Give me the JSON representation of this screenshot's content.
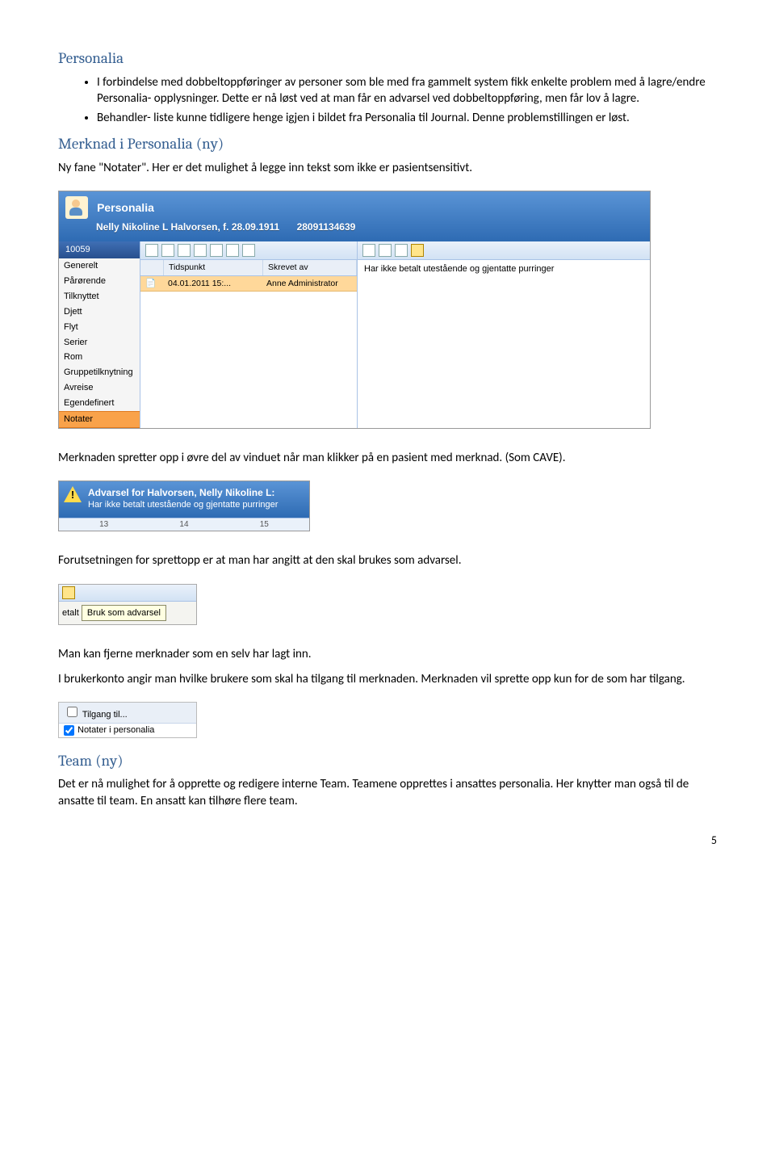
{
  "sections": {
    "personalia": {
      "heading": "Personalia",
      "bullets": [
        "I forbindelse med dobbeltoppføringer av personer som ble med fra gammelt system fikk enkelte problem med å lagre/endre Personalia- opplysninger. Dette er nå løst ved at man får en advarsel ved dobbeltoppføring, men får lov å lagre.",
        "Behandler- liste kunne tidligere henge igjen i bildet fra Personalia til Journal. Denne problemstillingen er løst."
      ]
    },
    "merknad": {
      "heading": "Merknad i Personalia (ny)",
      "intro": "Ny fane \"Notater\". Her er det mulighet å legge inn tekst som ikke er pasientsensitivt."
    },
    "body_p1": "Merknaden spretter opp i øvre del av vinduet når man klikker på en pasient med merknad. (Som CAVE).",
    "body_p2": "Forutsetningen for sprettopp er at man har angitt at den skal brukes som advarsel.",
    "body_p3": "Man kan fjerne merknader som en selv har lagt inn.",
    "body_p4": "I brukerkonto angir man hvilke brukere som skal ha tilgang til merknaden. Merknaden vil sprette opp kun for de som har tilgang.",
    "team": {
      "heading": "Team (ny)",
      "body": "Det er nå mulighet for å opprette og redigere interne Team. Teamene opprettes i ansattes personalia. Her knytter man også til de ansatte til team. En ansatt kan tilhøre flere team."
    }
  },
  "pwin": {
    "title": "Personalia",
    "subtitle": "Nelly Nikoline L Halvorsen, f. 28.09.1911",
    "idnum": "28091134639",
    "sidetab": "10059",
    "sidebar": [
      "Generelt",
      "Pårørende",
      "Tilknyttet",
      "Djett",
      "Flyt",
      "Serier",
      "Rom",
      "Gruppetilknytning",
      "Avreise",
      "Egendefinert",
      "Notater"
    ],
    "selected": "Notater",
    "listhead": {
      "c1": "",
      "c2": "Tidspunkt",
      "c3": "Skrevet av"
    },
    "listrow": {
      "c1": "",
      "c2": "04.01.2011 15:...",
      "c3": "Anne Administrator"
    },
    "rtext": "Har ikke betalt utestående og gjentatte purringer"
  },
  "adv": {
    "title": "Advarsel for Halvorsen, Nelly Nikoline L:",
    "body": "Har ikke betalt utestående og gjentatte purringer",
    "ruler": [
      "13",
      "14",
      "15"
    ]
  },
  "tooltip": {
    "label": "etalt",
    "tip": "Bruk som advarsel"
  },
  "chk": {
    "head": "Tilgang til...",
    "item": "Notater i personalia"
  },
  "pageno": "5"
}
